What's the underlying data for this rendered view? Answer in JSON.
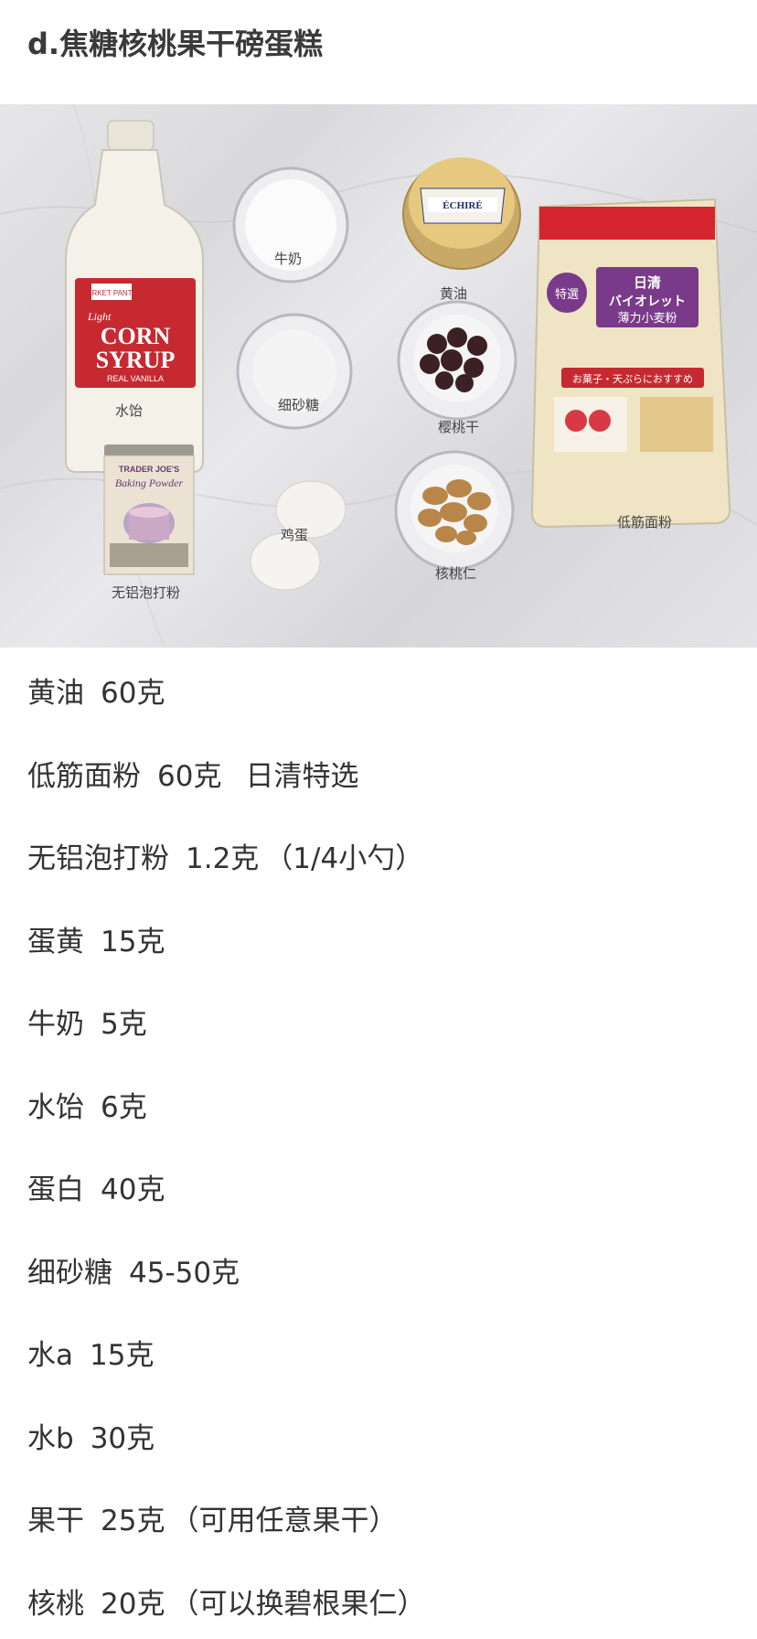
{
  "title": "d.焦糖核桃果干磅蛋糕",
  "photo": {
    "labels": {
      "corn_syrup": "水饴",
      "milk": "牛奶",
      "butter": "黄油",
      "sugar": "细砂糖",
      "cherries": "樱桃干",
      "eggs": "鸡蛋",
      "walnuts": "核桃仁",
      "baking_powder": "无铝泡打粉",
      "flour": "低筋面粉"
    },
    "packaging": {
      "corn_line1": "CORN",
      "corn_line2": "SYRUP",
      "corn_line3": "REAL VANILLA",
      "corn_brand": "MARKET PANTRY",
      "corn_script": "Light",
      "butter_brand": "ÉCHIRÉ",
      "bp_brand": "TRADER JOE'S",
      "bp_name": "Baking Powder",
      "flour_brand": "日清",
      "flour_kana": "バイオレット",
      "flour_type": "薄力小麦粉",
      "flour_tag": "特選",
      "flour_sub": "お菓子・天ぷらにおすすめ"
    }
  },
  "ingredients": [
    {
      "name": "黄油",
      "amount": "60克",
      "note": ""
    },
    {
      "name": "低筋面粉",
      "amount": "60克",
      "note": "日清特选"
    },
    {
      "name": "无铝泡打粉",
      "amount": "1.2克",
      "note": "（1/4小勺）"
    },
    {
      "name": "蛋黄",
      "amount": "15克",
      "note": ""
    },
    {
      "name": "牛奶",
      "amount": "5克",
      "note": ""
    },
    {
      "name": "水饴",
      "amount": "6克",
      "note": ""
    },
    {
      "name": "蛋白",
      "amount": "40克",
      "note": ""
    },
    {
      "name": "细砂糖",
      "amount": "45-50克",
      "note": ""
    },
    {
      "name": "水a",
      "amount": "15克",
      "note": ""
    },
    {
      "name": "水b",
      "amount": "30克",
      "note": ""
    },
    {
      "name": "果干",
      "amount": "25克",
      "note": "（可用任意果干）"
    },
    {
      "name": "核桃",
      "amount": "20克",
      "note": "（可以换碧根果仁）"
    }
  ]
}
